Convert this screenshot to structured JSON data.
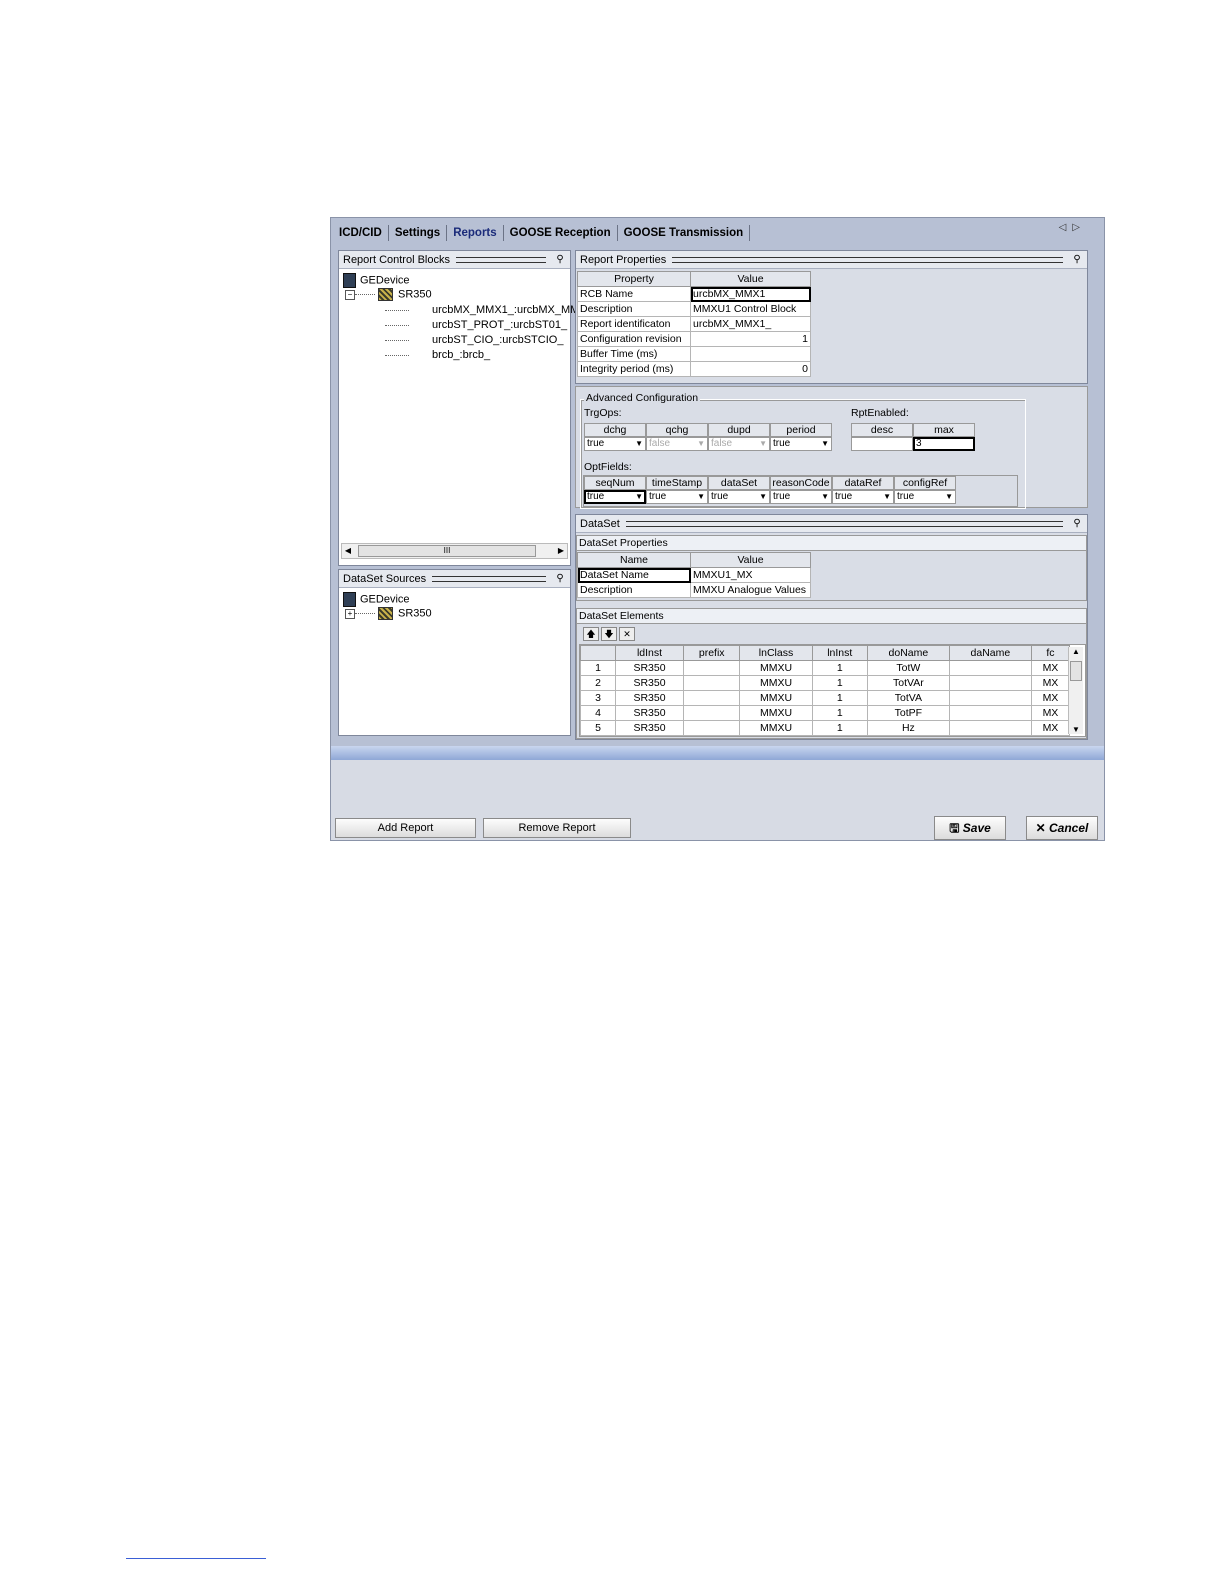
{
  "tabs": [
    "ICD/CID",
    "Settings",
    "Reports",
    "GOOSE Reception",
    "GOOSE Transmission"
  ],
  "active_tab": "Reports",
  "rcb_panel": {
    "title": "Report Control Blocks",
    "device": "GEDevice",
    "ied": "SR350",
    "items": [
      "urcbMX_MMX1_:urcbMX_MM",
      "urcbST_PROT_:urcbST01_",
      "urcbST_CIO_:urcbSTCIO_",
      "brcb_:brcb_"
    ]
  },
  "sources_panel": {
    "title": "DataSet Sources",
    "device": "GEDevice",
    "ied": "SR350"
  },
  "report_properties": {
    "title": "Report Properties",
    "headers": [
      "Property",
      "Value"
    ],
    "rows": [
      [
        "RCB Name",
        "urcbMX_MMX1"
      ],
      [
        "Description",
        "MMXU1 Control Block"
      ],
      [
        "Report identificaton",
        "urcbMX_MMX1_"
      ],
      [
        "Configuration revision",
        "1"
      ],
      [
        "Buffer Time (ms)",
        ""
      ],
      [
        "Integrity period (ms)",
        "0"
      ]
    ]
  },
  "advanced": {
    "title": "Advanced Configuration",
    "trgops_label": "TrgOps:",
    "trgops": [
      {
        "name": "dchg",
        "value": "true"
      },
      {
        "name": "qchg",
        "value": "false"
      },
      {
        "name": "dupd",
        "value": "false"
      },
      {
        "name": "period",
        "value": "true"
      }
    ],
    "rpt_label": "RptEnabled:",
    "rpt": [
      {
        "name": "desc",
        "value": ""
      },
      {
        "name": "max",
        "value": "3"
      }
    ],
    "optfields_label": "OptFields:",
    "optfields": [
      {
        "name": "seqNum",
        "value": "true"
      },
      {
        "name": "timeStamp",
        "value": "true"
      },
      {
        "name": "dataSet",
        "value": "true"
      },
      {
        "name": "reasonCode",
        "value": "true"
      },
      {
        "name": "dataRef",
        "value": "true"
      },
      {
        "name": "configRef",
        "value": "true"
      }
    ]
  },
  "dataset": {
    "title": "DataSet",
    "props_title": "DataSet Properties",
    "props_headers": [
      "Name",
      "Value"
    ],
    "props_rows": [
      [
        "DataSet Name",
        "MMXU1_MX"
      ],
      [
        "Description",
        "MMXU Analogue Values"
      ]
    ],
    "elements_title": "DataSet Elements",
    "columns": [
      "",
      "ldInst",
      "prefix",
      "lnClass",
      "lnInst",
      "doName",
      "daName",
      "fc"
    ],
    "rows": [
      [
        "1",
        "SR350",
        "",
        "MMXU",
        "1",
        "TotW",
        "",
        "MX"
      ],
      [
        "2",
        "SR350",
        "",
        "MMXU",
        "1",
        "TotVAr",
        "",
        "MX"
      ],
      [
        "3",
        "SR350",
        "",
        "MMXU",
        "1",
        "TotVA",
        "",
        "MX"
      ],
      [
        "4",
        "SR350",
        "",
        "MMXU",
        "1",
        "TotPF",
        "",
        "MX"
      ],
      [
        "5",
        "SR350",
        "",
        "MMXU",
        "1",
        "Hz",
        "",
        "MX"
      ]
    ]
  },
  "buttons": {
    "add": "Add Report",
    "remove": "Remove Report",
    "save": "Save",
    "cancel": "Cancel"
  }
}
